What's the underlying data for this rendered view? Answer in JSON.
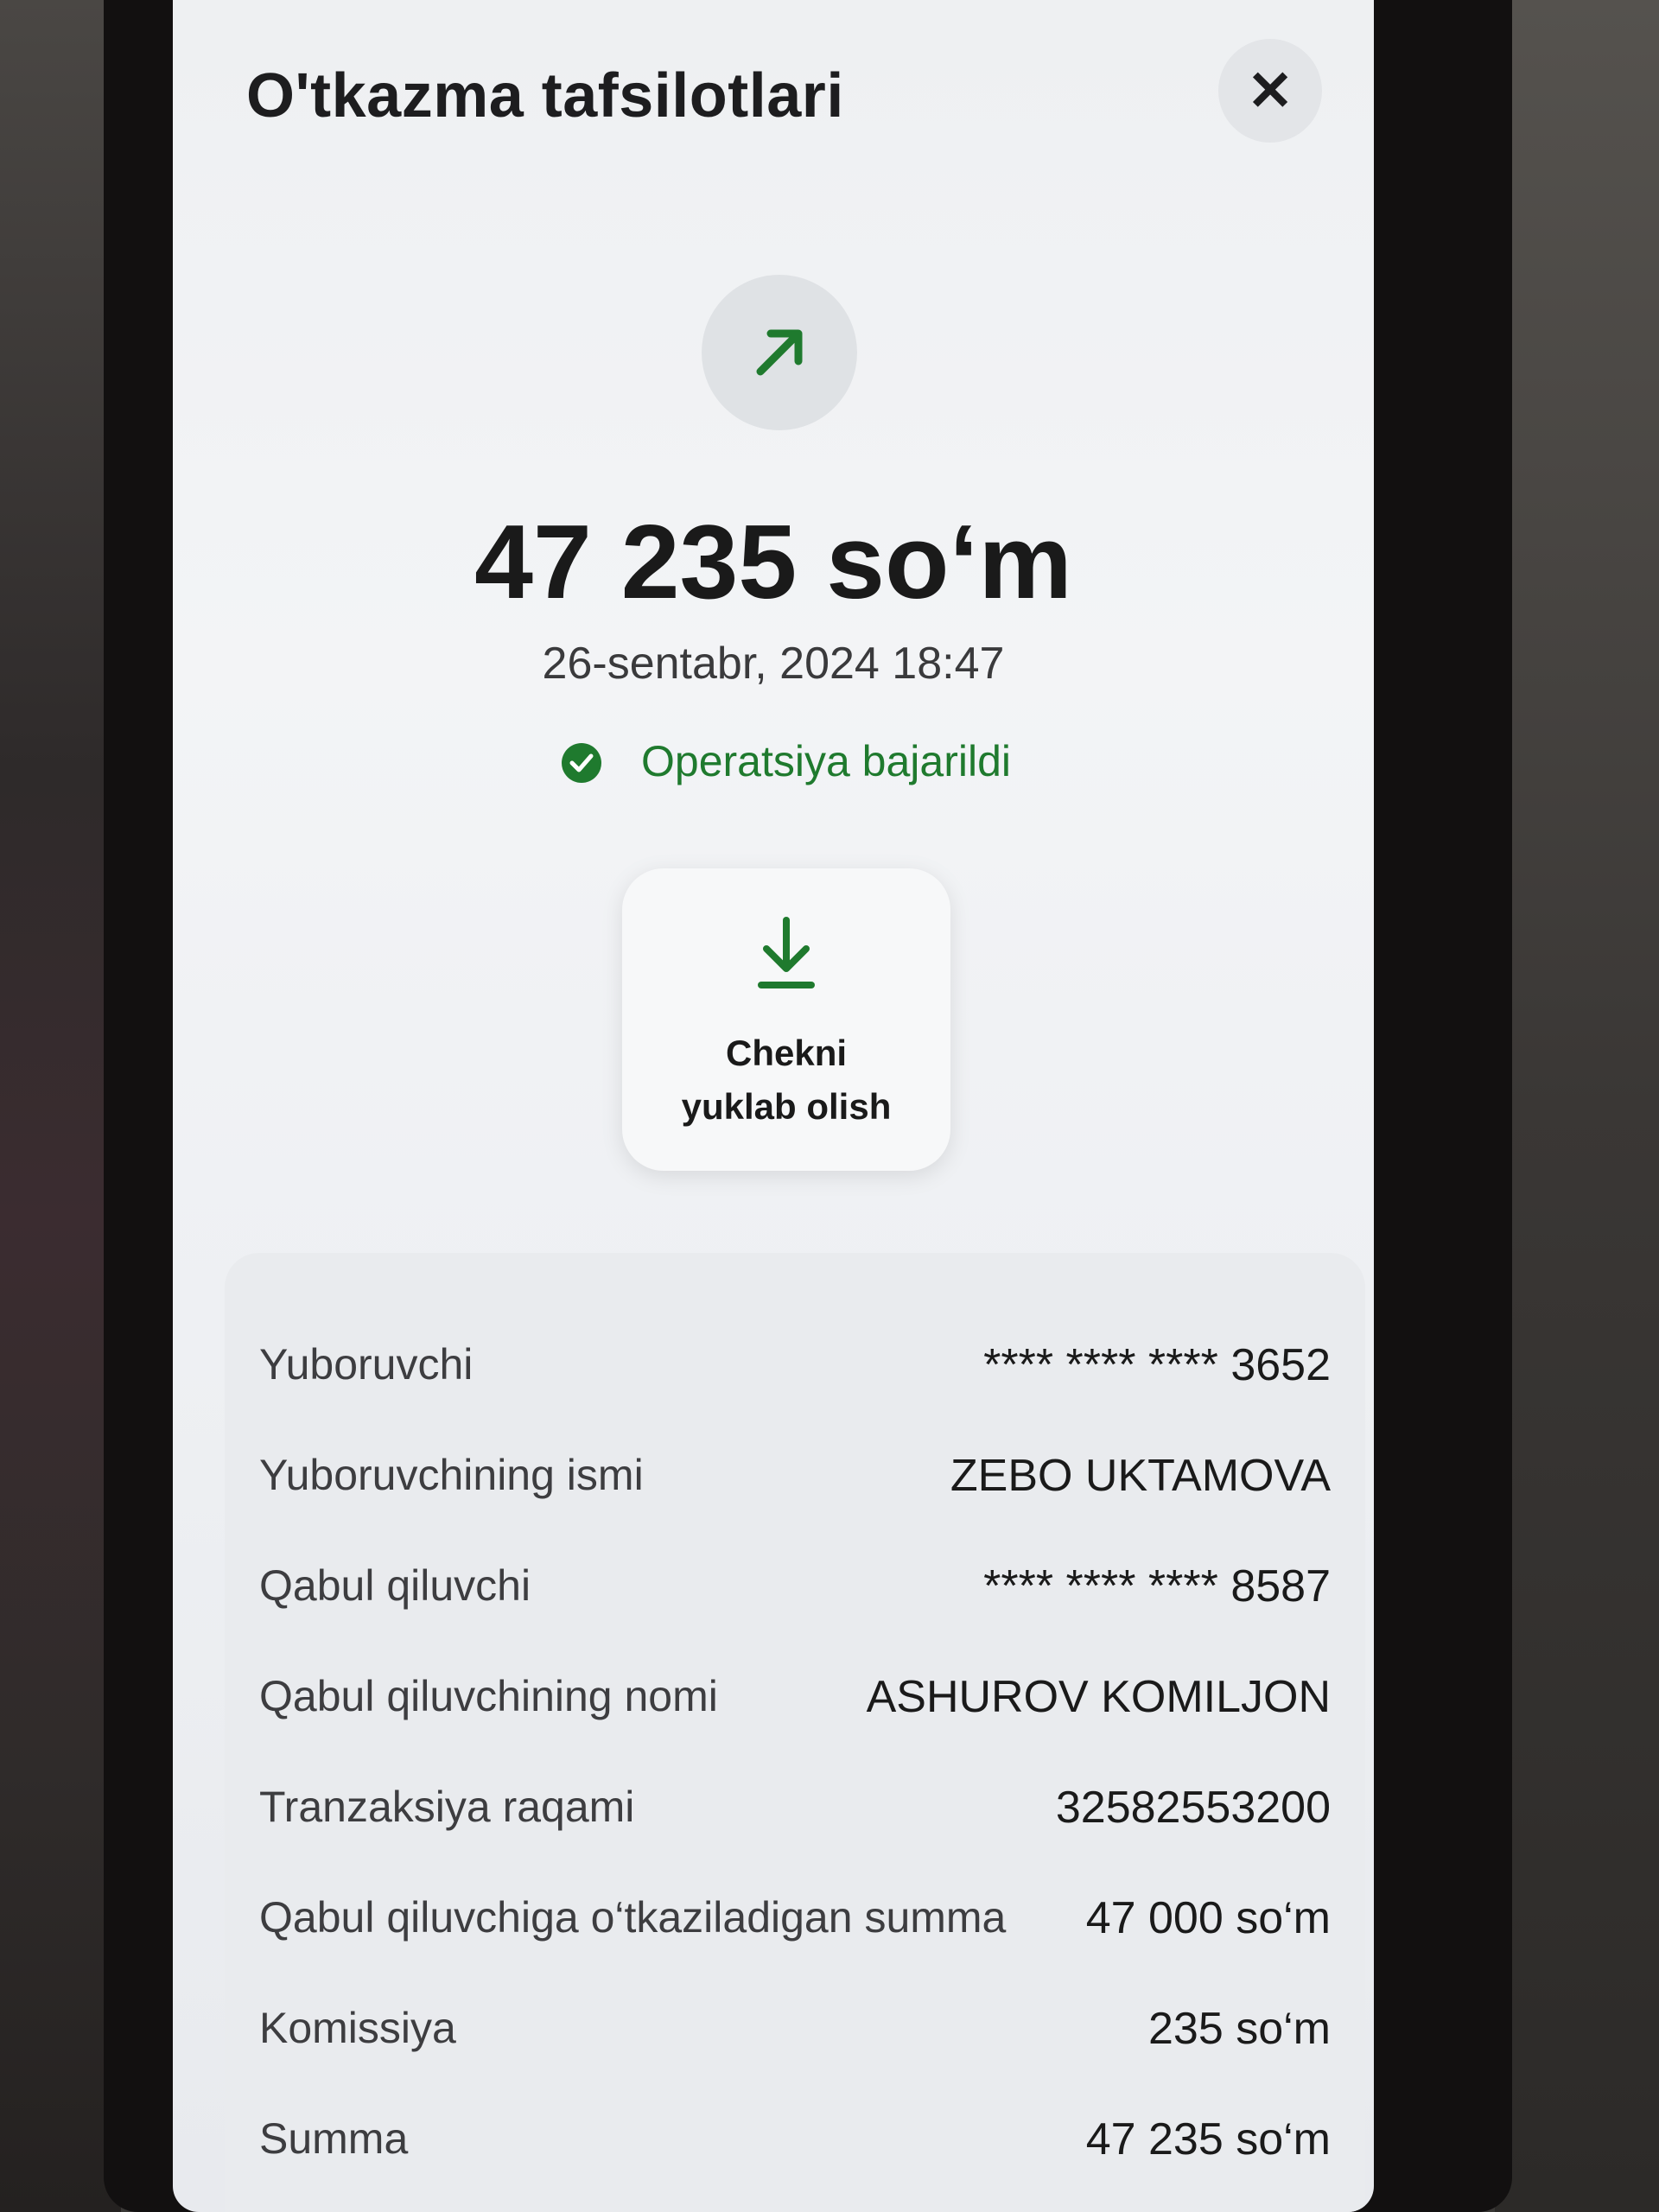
{
  "header": {
    "title": "O'tkazma tafsilotlari",
    "close_symbol": "✕"
  },
  "summary": {
    "amount": "47 235 so‘m",
    "datetime": "26-sentabr, 2024 18:47",
    "status": "Operatsiya bajarildi",
    "status_color": "#1f7a2e",
    "direction_icon": "arrow-up-right-icon"
  },
  "download": {
    "line1": "Chekni",
    "line2": "yuklab olish",
    "icon": "download-icon"
  },
  "details": [
    {
      "label": "Yuboruvchi",
      "value": "**** **** **** 3652"
    },
    {
      "label": "Yuboruvchining ismi",
      "value": "ZEBO UKTAMOVA"
    },
    {
      "label": "Qabul qiluvchi",
      "value": "**** **** **** 8587"
    },
    {
      "label": "Qabul qiluvchining nomi",
      "value": "ASHUROV KOMILJON"
    },
    {
      "label": "Tranzaksiya raqami",
      "value": "32582553200"
    },
    {
      "label": "Qabul qiluvchiga o‘tkaziladigan summa",
      "value": "47 000 so‘m"
    },
    {
      "label": "Komissiya",
      "value": "235 so‘m"
    },
    {
      "label": "Summa",
      "value": "47 235 so‘m"
    }
  ]
}
